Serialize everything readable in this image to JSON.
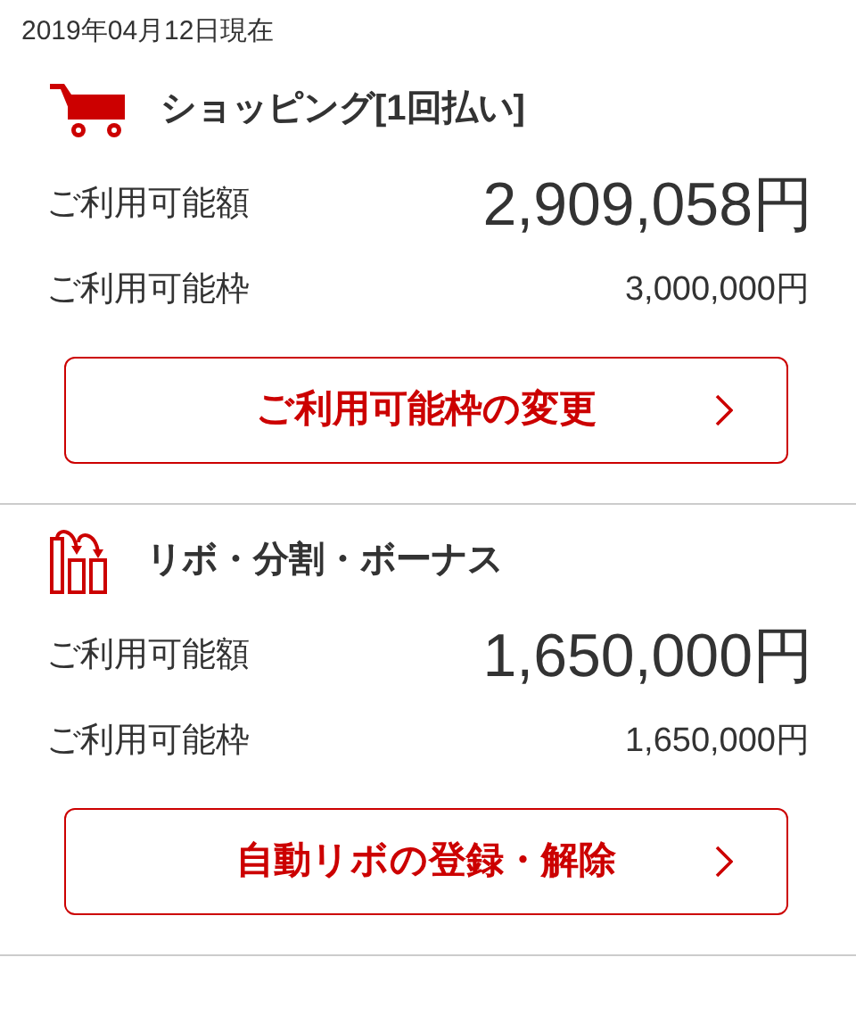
{
  "as_of": "2019年04月12日現在",
  "sections": [
    {
      "kind": "cart",
      "title": "ショッピング[1回払い]",
      "available_label": "ご利用可能額",
      "available": "2,909,058円",
      "limit_label": "ご利用可能枠",
      "limit": "3,000,000円",
      "button": "ご利用可能枠の変更"
    },
    {
      "kind": "revolving",
      "title": "リボ・分割・ボーナス",
      "available_label": "ご利用可能額",
      "available": "1,650,000円",
      "limit_label": "ご利用可能枠",
      "limit": "1,650,000円",
      "button": "自動リボの登録・解除"
    }
  ]
}
